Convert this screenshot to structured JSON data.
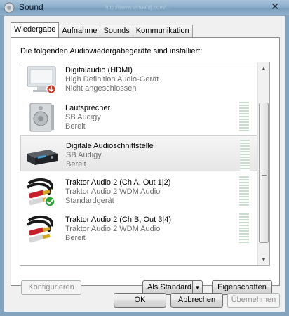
{
  "window": {
    "title": "Sound",
    "close_glyph": "✕"
  },
  "tabs": [
    {
      "label": "Wiedergabe",
      "active": true
    },
    {
      "label": "Aufnahme",
      "active": false
    },
    {
      "label": "Sounds",
      "active": false
    },
    {
      "label": "Kommunikation",
      "active": false
    }
  ],
  "panel": {
    "header": "Die folgenden Audiowiedergabegeräte sind installiert:"
  },
  "devices": [
    {
      "name": "Digitalaudio (HDMI)",
      "driver": "High Definition Audio-Gerät",
      "status": "Nicht angeschlossen",
      "icon": "monitor-icon",
      "selected": false
    },
    {
      "name": "Lautsprecher",
      "driver": "SB Audigy",
      "status": "Bereit",
      "icon": "speaker-icon",
      "selected": false
    },
    {
      "name": "Digitale Audioschnittstelle",
      "driver": "SB Audigy",
      "status": "Bereit",
      "icon": "audio-receiver-icon",
      "selected": true
    },
    {
      "name": "Traktor Audio 2 (Ch A, Out 1|2)",
      "driver": "Traktor Audio 2 WDM Audio",
      "status": "Standardgerät",
      "icon": "rca-cable-icon",
      "default": true,
      "selected": false
    },
    {
      "name": "Traktor Audio 2 (Ch B, Out 3|4)",
      "driver": "Traktor Audio 2 WDM Audio",
      "status": "Bereit",
      "icon": "rca-cable-icon",
      "selected": false
    }
  ],
  "buttons": {
    "configure": "Konfigurieren",
    "set_default": "Als Standard",
    "properties": "Eigenschaften",
    "ok": "OK",
    "cancel": "Abbrechen",
    "apply": "Übernehmen"
  },
  "colors": {
    "titlebar": "#8aaecb",
    "meter": "#c9ddcf",
    "default_check": "#2fa23a",
    "disconnected_badge": "#d13a2a"
  }
}
